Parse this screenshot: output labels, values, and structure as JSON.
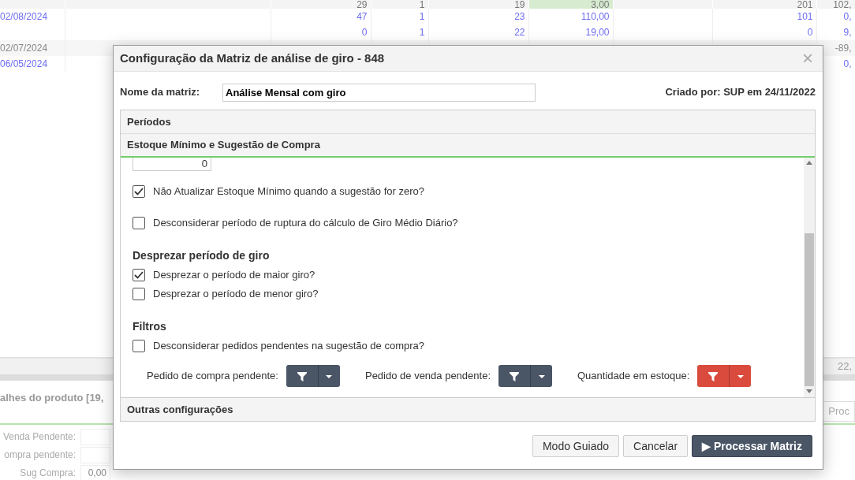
{
  "background": {
    "rows": [
      {
        "kind": "header",
        "cells": [
          null,
          null,
          "29",
          "1",
          "19",
          "3,00",
          null,
          "201",
          "102,"
        ]
      },
      {
        "kind": "link",
        "cells": [
          "02/08/2024",
          null,
          "47",
          "1",
          "23",
          "110,00",
          null,
          "101",
          "0,"
        ]
      },
      {
        "kind": "link",
        "cells": [
          null,
          null,
          "0",
          "1",
          "22",
          "19,00",
          null,
          "0",
          "9,"
        ]
      },
      {
        "kind": "muted",
        "cells": [
          "02/07/2024",
          null,
          null,
          null,
          null,
          null,
          null,
          null,
          "-89,"
        ]
      },
      {
        "kind": "link",
        "cells": [
          "06/05/2024",
          null,
          null,
          null,
          null,
          null,
          null,
          null,
          "0,"
        ]
      }
    ],
    "total": "22,",
    "details_title": "alhes do produto [19,",
    "detail_fields": [
      {
        "label": "Venda Pendente:"
      },
      {
        "label": "ompra pendente:"
      },
      {
        "label": "Sug Compra:",
        "value": "0,00"
      }
    ],
    "right_button": "Proc"
  },
  "dialog": {
    "title": "Configuração da Matriz de análise de giro - 848",
    "close": "×",
    "name_label": "Nome da matriz:",
    "name_value": "Análise Mensal com giro",
    "created": "Criado por: SUP em 24/11/2022",
    "sections": [
      {
        "title": "Períodos",
        "expanded": false
      },
      {
        "title": "Estoque Mínimo e Sugestão de Compra",
        "expanded": true
      }
    ],
    "top_field_value": "0",
    "items": [
      {
        "kind": "checkbox",
        "label": "Não Atualizar Estoque Mínimo quando a sugestão for zero?",
        "checked": true
      },
      {
        "kind": "checkbox",
        "label": "Desconsiderar período de ruptura do cálculo de Giro Médio Diário?",
        "checked": false
      },
      {
        "kind": "heading",
        "label": "Desprezar período de giro"
      },
      {
        "kind": "checkbox",
        "label": "Desprezar o período de maior giro?",
        "checked": true
      },
      {
        "kind": "checkbox",
        "label": "Desprezar o período de menor giro?",
        "checked": false
      },
      {
        "kind": "heading",
        "label": "Filtros"
      },
      {
        "kind": "checkbox",
        "label": "Desconsiderar pedidos pendentes na sugestão de compra?",
        "checked": false
      }
    ],
    "filters": [
      {
        "label": "Pedido de compra pendente:",
        "active": false
      },
      {
        "label": "Pedido de venda pendente:",
        "active": false
      },
      {
        "label": "Quantidade em estoque:",
        "active": true
      }
    ],
    "last_section": "Outras configurações",
    "buttons": [
      {
        "label": "Modo Guiado",
        "kind": "default"
      },
      {
        "label": "Cancelar",
        "kind": "default"
      },
      {
        "label": "Processar Matriz",
        "kind": "primary",
        "icon": "▶"
      }
    ]
  }
}
